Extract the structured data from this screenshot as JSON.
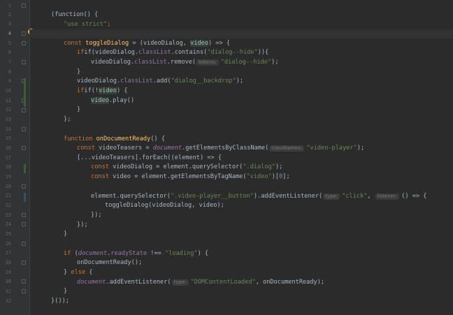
{
  "gutter": {
    "line_numbers": [
      "1",
      "2",
      "3",
      "4",
      "5",
      "6",
      "7",
      "8",
      "9",
      "10",
      "11",
      "12",
      "13",
      "14",
      "15",
      "16",
      "17",
      "18",
      "19",
      "20",
      "21",
      "22",
      "23",
      "24",
      "25",
      "26",
      "27",
      "28",
      "29",
      "30",
      "31",
      "32"
    ]
  },
  "code": {
    "l1": {
      "a": "(function() {"
    },
    "l2": {
      "s": "\"use strict\"",
      "p": ";"
    },
    "l4": {
      "k": "const ",
      "f": "toggleDialog",
      "a": " = (videoDialog, ",
      "v": "video",
      "b": ") => {"
    },
    "l5": {
      "a": "if(videoDialog.",
      "p1": "classList",
      "a2": ".contains(",
      "s": "\"dialog--hide\"",
      "b": ")){"
    },
    "l6": {
      "a": "videoDialog.",
      "p1": "classList",
      "a2": ".remove(",
      "hint": "tokens:",
      "s": "\"dialog--hide\"",
      "b": ");"
    },
    "l7": {
      "a": "}"
    },
    "l8": {
      "a": "videoDialog.",
      "p1": "classList",
      "a2": ".add(",
      "s": "\"dialog__backdrop\"",
      "b": ");"
    },
    "l9": {
      "a": "if(!",
      "v": "video",
      "b": ") {"
    },
    "l10": {
      "v": "video",
      "a": ".play()"
    },
    "l11": {
      "a": "}"
    },
    "l12": {
      "a": "};"
    },
    "l14": {
      "k": "function ",
      "f": "onDocumentReady",
      "a": "() {"
    },
    "l15": {
      "k": "const ",
      "a": "videoTeasers = ",
      "g": "document",
      "a2": ".getElementsByClassName(",
      "hint": "classNames:",
      "s": "\"video-player\"",
      "b": ");"
    },
    "l16": {
      "a": "[...videoTeasers].forEach((element) => {"
    },
    "l17": {
      "k": "const ",
      "a": "videoDialog = element.querySelector(",
      "s": "\".dialog\"",
      "b": ");"
    },
    "l18": {
      "k": "const ",
      "a": "video = element.getElementsByTagName(",
      "s": "\"video\"",
      "b": ")[",
      "n": "0",
      "c": "];"
    },
    "l20": {
      "a": "element.querySelector(",
      "s": "\".video-player__button\"",
      "a2": ").addEventListener(",
      "hint1": "type:",
      "s2": "\"click\"",
      "a3": ", ",
      "hint2": "listener:",
      "b": "() => {"
    },
    "l21": {
      "a": "toggleDialog(videoDialog, video);"
    },
    "l22": {
      "a": "});"
    },
    "l23": {
      "a": "});"
    },
    "l24": {
      "a": "}"
    },
    "l26": {
      "k": "if ",
      "a": "(",
      "g": "document",
      "a2": ".",
      "p1": "readyState",
      "a3": " !== ",
      "s": "\"loading\"",
      "b": ") {"
    },
    "l27": {
      "a": "onDocumentReady();"
    },
    "l28": {
      "a": "} ",
      "k": "else",
      "b": " {"
    },
    "l29": {
      "g": "document",
      "a": ".addEventListener(",
      "hint": "type:",
      "s": "\"DOMContentLoaded\"",
      "b": ", onDocumentReady);"
    },
    "l30": {
      "a": "}"
    },
    "l31": {
      "a": "}());"
    }
  }
}
